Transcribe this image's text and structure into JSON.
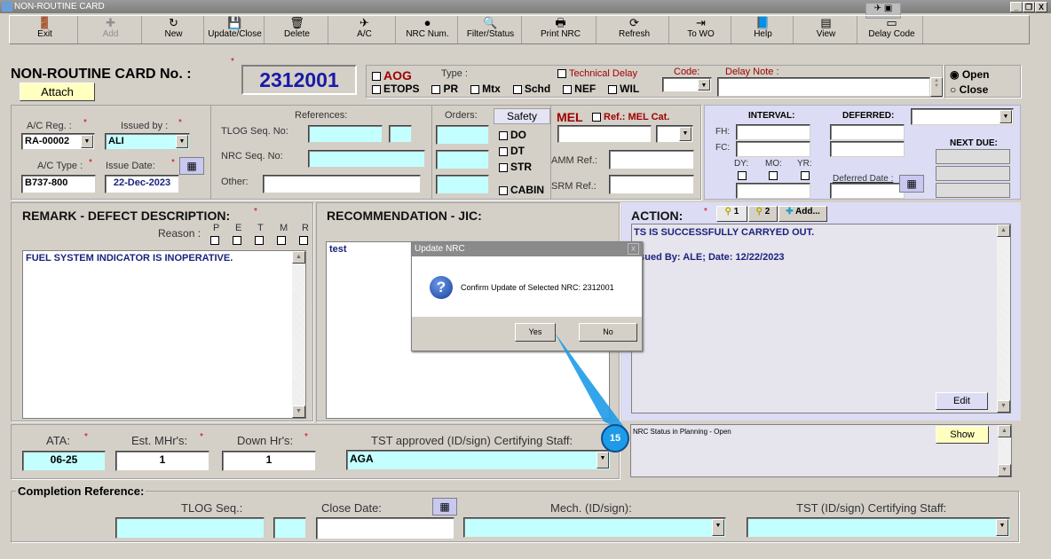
{
  "window": {
    "title": "NON-ROUTINE CARD",
    "min": "_",
    "max": "❐",
    "close": "X"
  },
  "toolbar": [
    {
      "label": "Exit",
      "icon": "exit-door-icon",
      "glyph": "🚪",
      "disabled": false
    },
    {
      "label": "Add",
      "icon": "plus-icon",
      "glyph": "✚",
      "disabled": true
    },
    {
      "label": "New",
      "icon": "new-arrow-icon",
      "glyph": "↻",
      "disabled": false
    },
    {
      "label": "Update/Close",
      "icon": "save-disk-icon",
      "glyph": "💾",
      "disabled": false
    },
    {
      "label": "Delete",
      "icon": "trash-icon",
      "glyph": "🗑",
      "disabled": false
    },
    {
      "label": "A/C",
      "icon": "airplane-icon",
      "glyph": "✈",
      "disabled": false
    },
    {
      "label": "NRC Num.",
      "icon": "nrc-number-icon",
      "glyph": "●",
      "disabled": false
    },
    {
      "label": "Filter/Status",
      "icon": "magnifier-icon",
      "glyph": "🔍",
      "disabled": false
    },
    {
      "label": "Print NRC",
      "icon": "printer-icon",
      "glyph": "🖶",
      "disabled": false
    },
    {
      "label": "Refresh",
      "icon": "refresh-icon",
      "glyph": "⟳",
      "disabled": false
    },
    {
      "label": "To WO",
      "icon": "to-wo-icon",
      "glyph": "⇥",
      "disabled": false
    },
    {
      "label": "Help",
      "icon": "help-book-icon",
      "glyph": "📘",
      "disabled": false
    },
    {
      "label": "View",
      "icon": "view-icon",
      "glyph": "▤",
      "disabled": false
    },
    {
      "label": "Delay Code",
      "icon": "delay-code-icon",
      "glyph": "▭",
      "disabled": false
    }
  ],
  "header": {
    "title": "NON-ROUTINE CARD No. :",
    "attach": "Attach",
    "nrc_number": "2312001",
    "req": "*"
  },
  "type_box": {
    "aog": "AOG",
    "type_label": "Type :",
    "technical_delay": "Technical Delay",
    "code_label": "Code:",
    "delay_note_label": "Delay Note :",
    "types": [
      "ETOPS",
      "PR",
      "Mtx",
      "Schd",
      "NEF",
      "WIL"
    ]
  },
  "status": {
    "open": "Open",
    "close": "Close",
    "selected": "Open"
  },
  "aircraft": {
    "reg_label": "A/C Reg. :",
    "reg": "RA-00002",
    "issued_by_label": "Issued by :",
    "issued_by": "ALI",
    "type_label": "A/C Type :",
    "type": "B737-800",
    "issue_date_label": "Issue Date:",
    "issue_date": "22-Dec-2023"
  },
  "references": {
    "title": "References:",
    "tlog": "TLOG Seq. No:",
    "nrc": "NRC Seq. No:",
    "other": "Other:"
  },
  "orders": {
    "title": "Orders:"
  },
  "safety": {
    "title": "Safety",
    "items": [
      "DO",
      "DT",
      "STR",
      "CABIN"
    ]
  },
  "mel": {
    "title": "MEL",
    "ref": "Ref.: MEL Cat.",
    "amm": "AMM Ref.:",
    "srm": "SRM Ref.:"
  },
  "interval": {
    "interval": "INTERVAL:",
    "deferred": "DEFERRED:",
    "fh": "FH:",
    "fc": "FC:",
    "dy": "DY:",
    "mo": "MO:",
    "yr": "YR:",
    "deferred_date": "Deferred Date :",
    "next_due": "NEXT DUE:"
  },
  "remark": {
    "title": "REMARK - DEFECT DESCRIPTION:",
    "reason": "Reason :",
    "reasons": [
      "P",
      "E",
      "T",
      "M",
      "R"
    ],
    "text": "FUEL SYSTEM INDICATOR IS INOPERATIVE."
  },
  "recommendation": {
    "title": "RECOMMENDATION - JIC:",
    "text": "test"
  },
  "action": {
    "title": "ACTION:",
    "tabs": [
      "1",
      "2",
      "Add..."
    ],
    "line1": "TS IS SUCCESSFULLY CARRYED OUT.",
    "line2": "ssued By: ALE; Date: 12/22/2023",
    "edit": "Edit"
  },
  "bottom": {
    "ata_label": "ATA:",
    "ata": "06-25",
    "mhrs_label": "Est. MHr's:",
    "mhrs": "1",
    "down_label": "Down Hr's:",
    "down": "1",
    "tst_label": "TST approved (ID/sign) Certifying Staff:",
    "tst": "AGA",
    "status_text": "NRC Status in Planning - Open",
    "show": "Show"
  },
  "completion": {
    "title": "Completion Reference:",
    "tlog": "TLOG Seq.:",
    "close_date": "Close Date:",
    "mech": "Mech. (ID/sign):",
    "tst": "TST (ID/sign) Certifying Staff:"
  },
  "dialog": {
    "title": "Update NRC",
    "message": "Confirm Update of Selected NRC: 2312001",
    "yes": "Yes",
    "no": "No",
    "close": "x"
  },
  "callout": {
    "step": "15"
  }
}
